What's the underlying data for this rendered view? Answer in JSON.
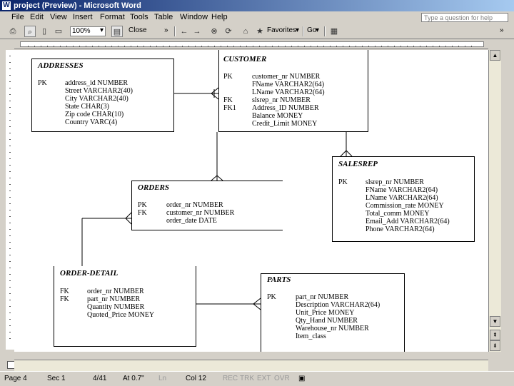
{
  "window": {
    "title": "project (Preview) - Microsoft Word"
  },
  "menu": [
    "File",
    "Edit",
    "View",
    "Insert",
    "Format",
    "Tools",
    "Table",
    "Window",
    "Help"
  ],
  "help_placeholder": "Type a question for help",
  "toolbar": {
    "zoom": "100%",
    "close_label": "Close",
    "favorites_label": "Favorites",
    "go_label": "Go"
  },
  "status": {
    "page": "Page 4",
    "sec": "Sec 1",
    "pages": "4/41",
    "at": "At 0.7\"",
    "ln": "Ln",
    "col": "Col 12",
    "rec": "REC",
    "trk": "TRK",
    "ext": "EXT",
    "ovr": "OVR"
  },
  "entities": {
    "addresses": {
      "name": "ADDRESSES",
      "key": "PK",
      "attrs": [
        "address_id NUMBER",
        "Street VARCHAR2(40)",
        "City VARCHAR2(40)",
        "State CHAR(3)",
        "Zip code CHAR(10)",
        "Country VARC(4)"
      ]
    },
    "customer": {
      "name": "CUSTOMER",
      "keys": [
        "PK",
        "FK",
        "FK1"
      ],
      "attrs": [
        "customer_nr NUMBER",
        "FName VARCHAR2(64)",
        "LName VARCHAR2(64)",
        "slsrep_nr NUMBER",
        "Address_ID NUMBER",
        "Balance MONEY",
        "Credit_Limit MONEY"
      ]
    },
    "salesrep": {
      "name": "SALESREP",
      "key": "PK",
      "attrs": [
        "slsrep_nr NUMBER",
        "FName VARCHAR2(64)",
        "LName VARCHAR2(64)",
        "Commission_rate MONEY",
        "Total_comm MONEY",
        "Email_Add VARCHAR2(64)",
        "Phone VARCHAR2(64)"
      ]
    },
    "orders": {
      "name": "ORDERS",
      "keys": [
        "PK",
        "FK"
      ],
      "attrs": [
        "order_nr NUMBER",
        "customer_nr NUMBER",
        "order_date DATE"
      ]
    },
    "order_detail": {
      "name": "ORDER-DETAIL",
      "keys": [
        "FK",
        "FK"
      ],
      "attrs": [
        "order_nr NUMBER",
        "part_nr NUMBER",
        "Quantity NUMBER",
        "Quoted_Price MONEY"
      ]
    },
    "parts": {
      "name": "PARTS",
      "key": "PK",
      "attrs": [
        "part_nr NUMBER",
        "Description VARCHAR2(64)",
        "Unit_Price        MONEY",
        "Qty_Hand NUMBER",
        "Warehouse_nr NUMBER",
        "Item_class"
      ]
    }
  }
}
